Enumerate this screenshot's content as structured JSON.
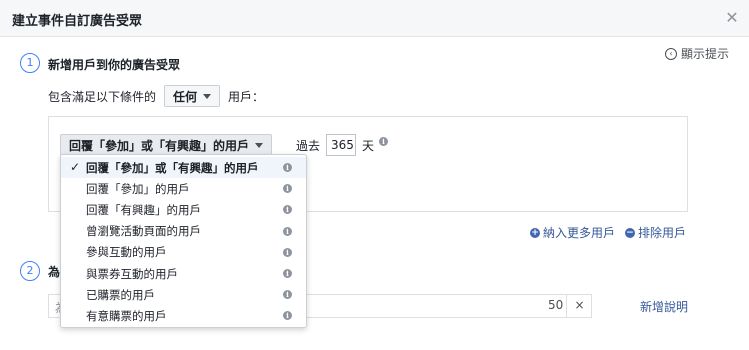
{
  "dialog": {
    "title": "建立事件自訂廣告受眾",
    "close_icon": "close-icon"
  },
  "hints": {
    "label": "顯示提示",
    "icon": "help-icon"
  },
  "step1": {
    "number": "1",
    "title": "新增用戶到你的廣告受眾"
  },
  "include_row": {
    "prefix": "包含滿足以下條件的",
    "select_value": "任何",
    "suffix": "用戶："
  },
  "rule": {
    "event_select_value": "回覆「參加」或「有興趣」的用戶",
    "past_label": "過去",
    "days_value": "365",
    "days_unit": "天"
  },
  "dropdown": {
    "items": [
      {
        "label": "回覆「參加」或「有興趣」的用戶",
        "selected": true
      },
      {
        "label": "回覆「參加」的用戶",
        "selected": false
      },
      {
        "label": "回覆「有興趣」的用戶",
        "selected": false
      },
      {
        "label": "曾瀏覽活動頁面的用戶",
        "selected": false
      },
      {
        "label": "參與互動的用戶",
        "selected": false
      },
      {
        "label": "與票券互動的用戶",
        "selected": false
      },
      {
        "label": "已購票的用戶",
        "selected": false
      },
      {
        "label": "有意購票的用戶",
        "selected": false
      }
    ]
  },
  "actions": {
    "include_more": "納入更多用戶",
    "exclude": "排除用戶"
  },
  "step2": {
    "number": "2",
    "title_partial": "為"
  },
  "description": {
    "placeholder_partial": "為",
    "char_count": "50",
    "clear_label": "×",
    "add_label": "新增說明"
  },
  "colors": {
    "accent": "#4080ff",
    "link": "#365899",
    "header_bg": "#f6f7f9",
    "border": "#dddfe2"
  }
}
